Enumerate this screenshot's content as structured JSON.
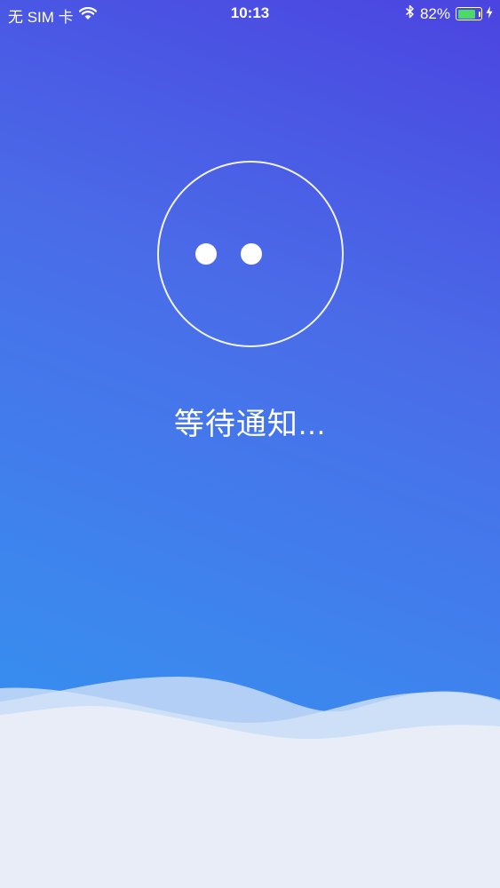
{
  "status_bar": {
    "carrier": "无 SIM 卡",
    "time": "10:13",
    "battery_percent_text": "82%",
    "battery_level": 0.82
  },
  "main": {
    "status_text": "等待通知..."
  },
  "colors": {
    "gradient_top": "#4B44E0",
    "gradient_bottom": "#2E96F0",
    "battery_fill": "#4CD964",
    "wave_front": "#E9EDF8"
  }
}
